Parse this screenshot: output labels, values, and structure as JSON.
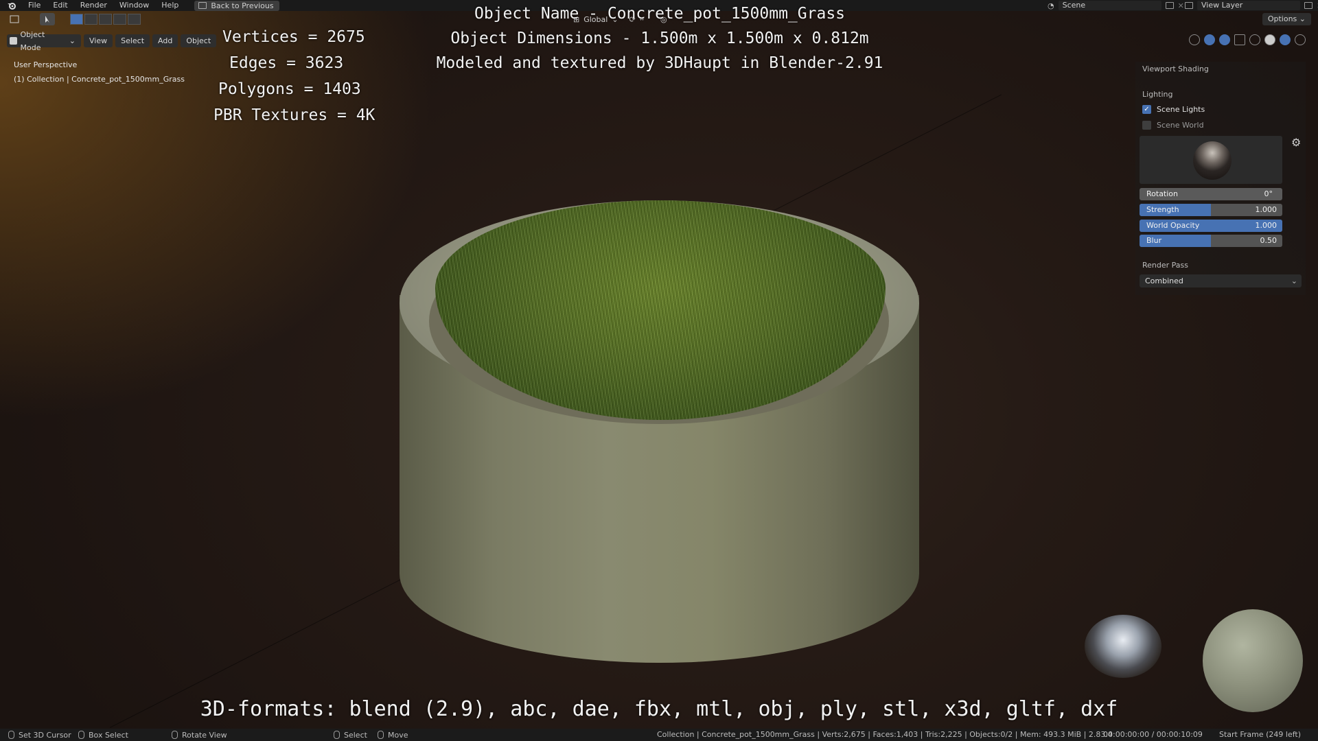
{
  "menu": {
    "items": [
      "File",
      "Edit",
      "Render",
      "Window",
      "Help"
    ],
    "back_button": "Back to Previous"
  },
  "top_right": {
    "scene": "Scene",
    "view_layer": "View Layer"
  },
  "header": {
    "transform_orientation": "Global",
    "options": "Options",
    "mode": "Object Mode",
    "view": "View",
    "select": "Select",
    "add": "Add",
    "object": "Object"
  },
  "viewport": {
    "perspective": "User Perspective",
    "collection": "(1) Collection | Concrete_pot_1500mm_Grass"
  },
  "overlay": {
    "vertices": "Vertices = 2675",
    "edges": "Edges = 3623",
    "polygons": "Polygons = 1403",
    "pbr": "PBR Textures = 4K",
    "object_name": "Object Name - Concrete_pot_1500mm_Grass",
    "dimensions": "Object Dimensions -  1.500m x 1.500m x 0.812m",
    "modeled_by": "Modeled and textured by 3DHaupt in Blender-2.91",
    "formats": "3D-formats: blend (2.9), abc, dae, fbx, mtl, obj, ply, stl, x3d, gltf, dxf"
  },
  "shading_panel": {
    "title": "Viewport Shading",
    "lighting_label": "Lighting",
    "scene_lights": "Scene Lights",
    "scene_lights_checked": true,
    "scene_world": "Scene World",
    "scene_world_checked": false,
    "rotation_label": "Rotation",
    "rotation_value": "0°",
    "strength_label": "Strength",
    "strength_value": "1.000",
    "strength_fill": 0.5,
    "world_opacity_label": "World Opacity",
    "world_opacity_value": "1.000",
    "world_opacity_fill": 1.0,
    "blur_label": "Blur",
    "blur_value": "0.50",
    "blur_fill": 0.5,
    "render_pass_label": "Render Pass",
    "render_pass_value": "Combined"
  },
  "statusbar": {
    "set_cursor": "Set 3D Cursor",
    "box_select": "Box Select",
    "rotate_view": "Rotate View",
    "select": "Select",
    "move": "Move",
    "stats": "Collection | Concrete_pot_1500mm_Grass | Verts:2,675 | Faces:1,403 | Tris:2,225 | Objects:0/2 | Mem: 493.3 MiB | 2.83.4",
    "time": "00:00:00:00 / 00:00:10:09",
    "start_frame": "Start Frame (249 left)"
  },
  "colors": {
    "accent": "#4772b3",
    "grass": "#587325",
    "concrete": "#858669"
  }
}
